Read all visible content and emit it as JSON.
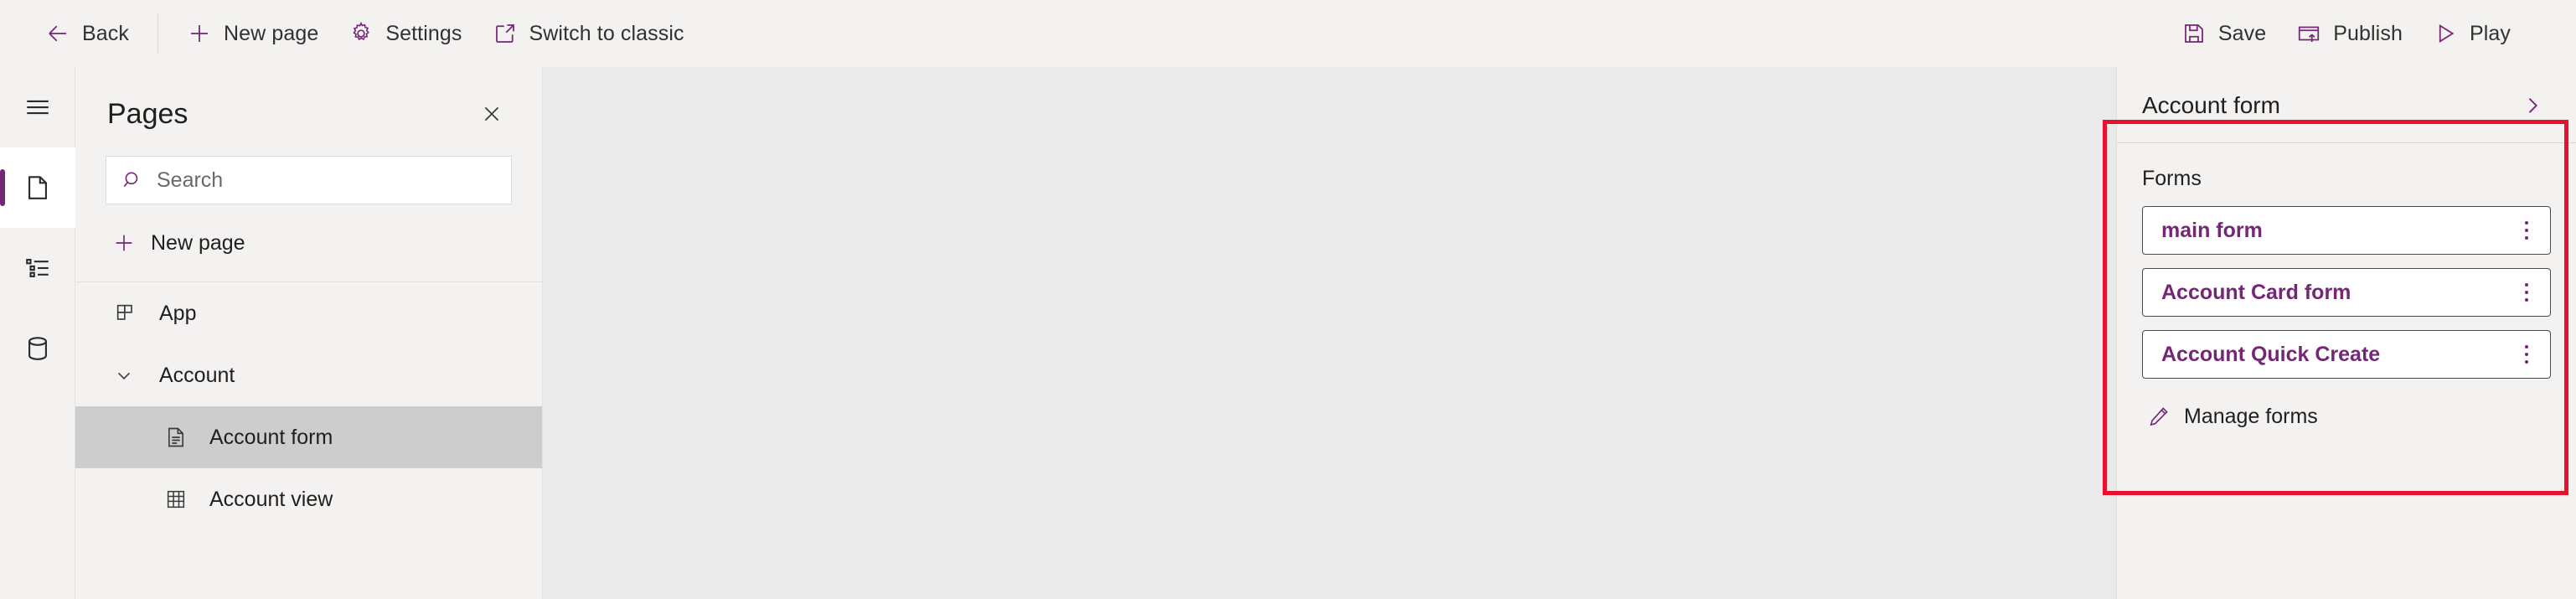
{
  "command_bar": {
    "left_items": [
      {
        "label": "Back",
        "icon": "arrow-left-icon",
        "name": "back-button"
      },
      {
        "label": "New page",
        "icon": "plus-icon",
        "name": "new-page-button"
      },
      {
        "label": "Settings",
        "icon": "gear-icon",
        "name": "settings-button"
      },
      {
        "label": "Switch to classic",
        "icon": "open-in-new-icon",
        "name": "switch-to-classic-button"
      }
    ],
    "right_items": [
      {
        "label": "Save",
        "icon": "save-icon",
        "name": "save-button"
      },
      {
        "label": "Publish",
        "icon": "publish-icon",
        "name": "publish-button"
      },
      {
        "label": "Play",
        "icon": "play-icon",
        "name": "play-button"
      }
    ]
  },
  "rail": {
    "items": [
      {
        "name": "hamburger-menu-icon",
        "icon": "hamburger-icon",
        "selected": false
      },
      {
        "name": "pages-icon",
        "icon": "page-icon",
        "selected": true
      },
      {
        "name": "navigation-icon",
        "icon": "list-tree-icon",
        "selected": false
      },
      {
        "name": "data-icon",
        "icon": "database-icon",
        "selected": false
      }
    ]
  },
  "pages_panel": {
    "title": "Pages",
    "close_icon": "close-icon",
    "search": {
      "placeholder": "Search",
      "value": "",
      "icon": "search-icon"
    },
    "new_page": {
      "label": "New page",
      "icon": "plus-icon"
    },
    "tree": [
      {
        "label": "App",
        "icon": "app-grid-icon",
        "level": 0,
        "selected": false,
        "expandable": false
      },
      {
        "label": "Account",
        "icon": "chevron-down-icon",
        "level": 0,
        "selected": false,
        "expandable": true
      },
      {
        "label": "Account form",
        "icon": "form-icon",
        "level": 1,
        "selected": true,
        "expandable": false
      },
      {
        "label": "Account view",
        "icon": "table-icon",
        "level": 1,
        "selected": false,
        "expandable": false
      }
    ]
  },
  "properties_panel": {
    "title": "Account form",
    "chevron_icon": "chevron-right-icon",
    "section_label": "Forms",
    "forms": [
      {
        "name": "main form"
      },
      {
        "name": "Account Card form"
      },
      {
        "name": "Account Quick Create"
      }
    ],
    "manage_forms": {
      "label": "Manage forms",
      "icon": "pencil-icon"
    },
    "kebab_icon": "more-options-icon"
  },
  "colors": {
    "accent_purple": "#742774",
    "annotation_red": "#e8102d",
    "chrome_bg": "#f3f2f1",
    "canvas_bg": "#eaeaea",
    "selected_row": "#cdcdcd"
  }
}
